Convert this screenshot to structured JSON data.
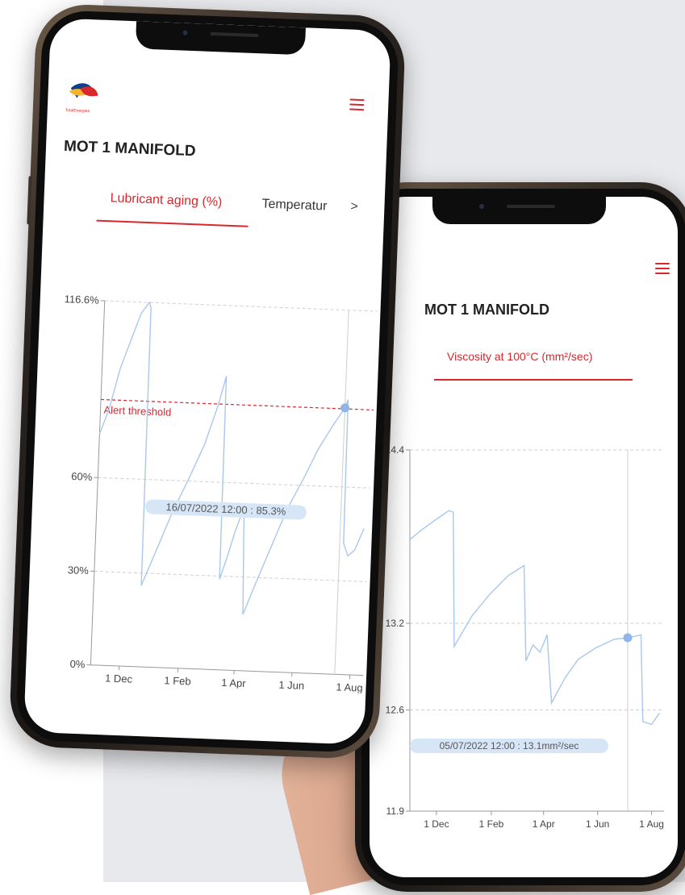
{
  "phone1": {
    "logo_text": "TotalEnergies",
    "title": "MOT 1 MANIFOLD",
    "tabs": [
      {
        "label": "Lubricant aging (%)",
        "active": true
      },
      {
        "label": "Temperatur",
        "active": false
      }
    ],
    "tab_next_icon": ">",
    "chart": {
      "y_ticks": [
        "116.6%",
        "60%",
        "30%",
        "0%"
      ],
      "x_ticks": [
        "1 Dec",
        "1 Feb",
        "1 Apr",
        "1 Jun",
        "1 Aug"
      ],
      "threshold_label": "Alert threshold",
      "tooltip": "16/07/2022 12:00 : 85.3%"
    }
  },
  "phone2": {
    "title": "MOT 1 MANIFOLD",
    "tabs": [
      {
        "label": "Viscosity at 100°C (mm²/sec)",
        "active": true
      }
    ],
    "chart": {
      "y_ticks": [
        "14.4",
        "13.2",
        "12.6",
        "11.9"
      ],
      "x_ticks": [
        "1 Dec",
        "1 Feb",
        "1 Apr",
        "1 Jun",
        "1 Aug"
      ],
      "tooltip": "05/07/2022 12:00 : 13.1mm²/sec"
    }
  },
  "colors": {
    "accent": "#d8272d",
    "series": "#a9c8ec",
    "marker": "#8fb6e6",
    "tooltip_bg": "#d6e6f7"
  },
  "chart_data": [
    {
      "type": "line",
      "title": "Lubricant aging (%)",
      "xlabel": "",
      "ylabel": "",
      "ylim": [
        0,
        116.6
      ],
      "x_tick_labels": [
        "1 Dec",
        "1 Feb",
        "1 Apr",
        "1 Jun",
        "1 Aug"
      ],
      "threshold": {
        "label": "Alert threshold",
        "value": 85
      },
      "highlight": {
        "x": "16/07/2022 12:00",
        "y": 85.3
      },
      "series": [
        {
          "x": [
            "2021-11-01",
            "2021-11-10",
            "2021-11-20",
            "2021-12-01",
            "2021-12-10",
            "2021-12-18",
            "2021-12-20",
            "2021-12-21",
            "2022-01-05",
            "2022-01-20",
            "2022-02-05",
            "2022-02-20",
            "2022-03-05",
            "2022-03-12",
            "2022-03-13",
            "2022-03-20",
            "2022-03-28",
            "2022-04-05",
            "2022-04-08",
            "2022-04-20",
            "2022-05-05",
            "2022-05-20",
            "2022-06-05",
            "2022-06-20",
            "2022-07-05",
            "2022-07-16",
            "2022-07-19",
            "2022-07-20",
            "2022-07-25",
            "2022-08-01",
            "2022-08-10"
          ],
          "values": [
            74,
            82,
            95,
            105,
            113,
            116.6,
            115,
            26,
            38,
            50,
            61,
            72,
            85,
            94,
            29,
            36,
            45,
            52,
            18,
            28,
            40,
            52,
            62,
            72,
            80,
            85.3,
            88,
            42,
            38,
            40,
            47
          ]
        }
      ]
    },
    {
      "type": "line",
      "title": "Viscosity at 100°C (mm²/sec)",
      "xlabel": "",
      "ylabel": "",
      "ylim": [
        11.9,
        14.4
      ],
      "x_tick_labels": [
        "1 Dec",
        "1 Feb",
        "1 Apr",
        "1 Jun",
        "1 Aug"
      ],
      "highlight": {
        "x": "05/07/2022 12:00",
        "y": 13.1
      },
      "series": [
        {
          "x": [
            "2021-11-01",
            "2021-11-15",
            "2021-12-01",
            "2021-12-15",
            "2021-12-20",
            "2021-12-21",
            "2022-01-10",
            "2022-01-30",
            "2022-02-20",
            "2022-03-10",
            "2022-03-12",
            "2022-03-20",
            "2022-03-28",
            "2022-04-05",
            "2022-04-10",
            "2022-04-25",
            "2022-05-10",
            "2022-05-30",
            "2022-06-20",
            "2022-07-05",
            "2022-07-20",
            "2022-07-22",
            "2022-08-01",
            "2022-08-10"
          ],
          "values": [
            13.78,
            13.85,
            13.92,
            13.98,
            13.97,
            13.04,
            13.25,
            13.4,
            13.53,
            13.6,
            12.94,
            13.05,
            13.0,
            13.12,
            12.65,
            12.82,
            12.95,
            13.03,
            13.09,
            13.1,
            13.12,
            12.52,
            12.5,
            12.58
          ]
        }
      ]
    }
  ]
}
